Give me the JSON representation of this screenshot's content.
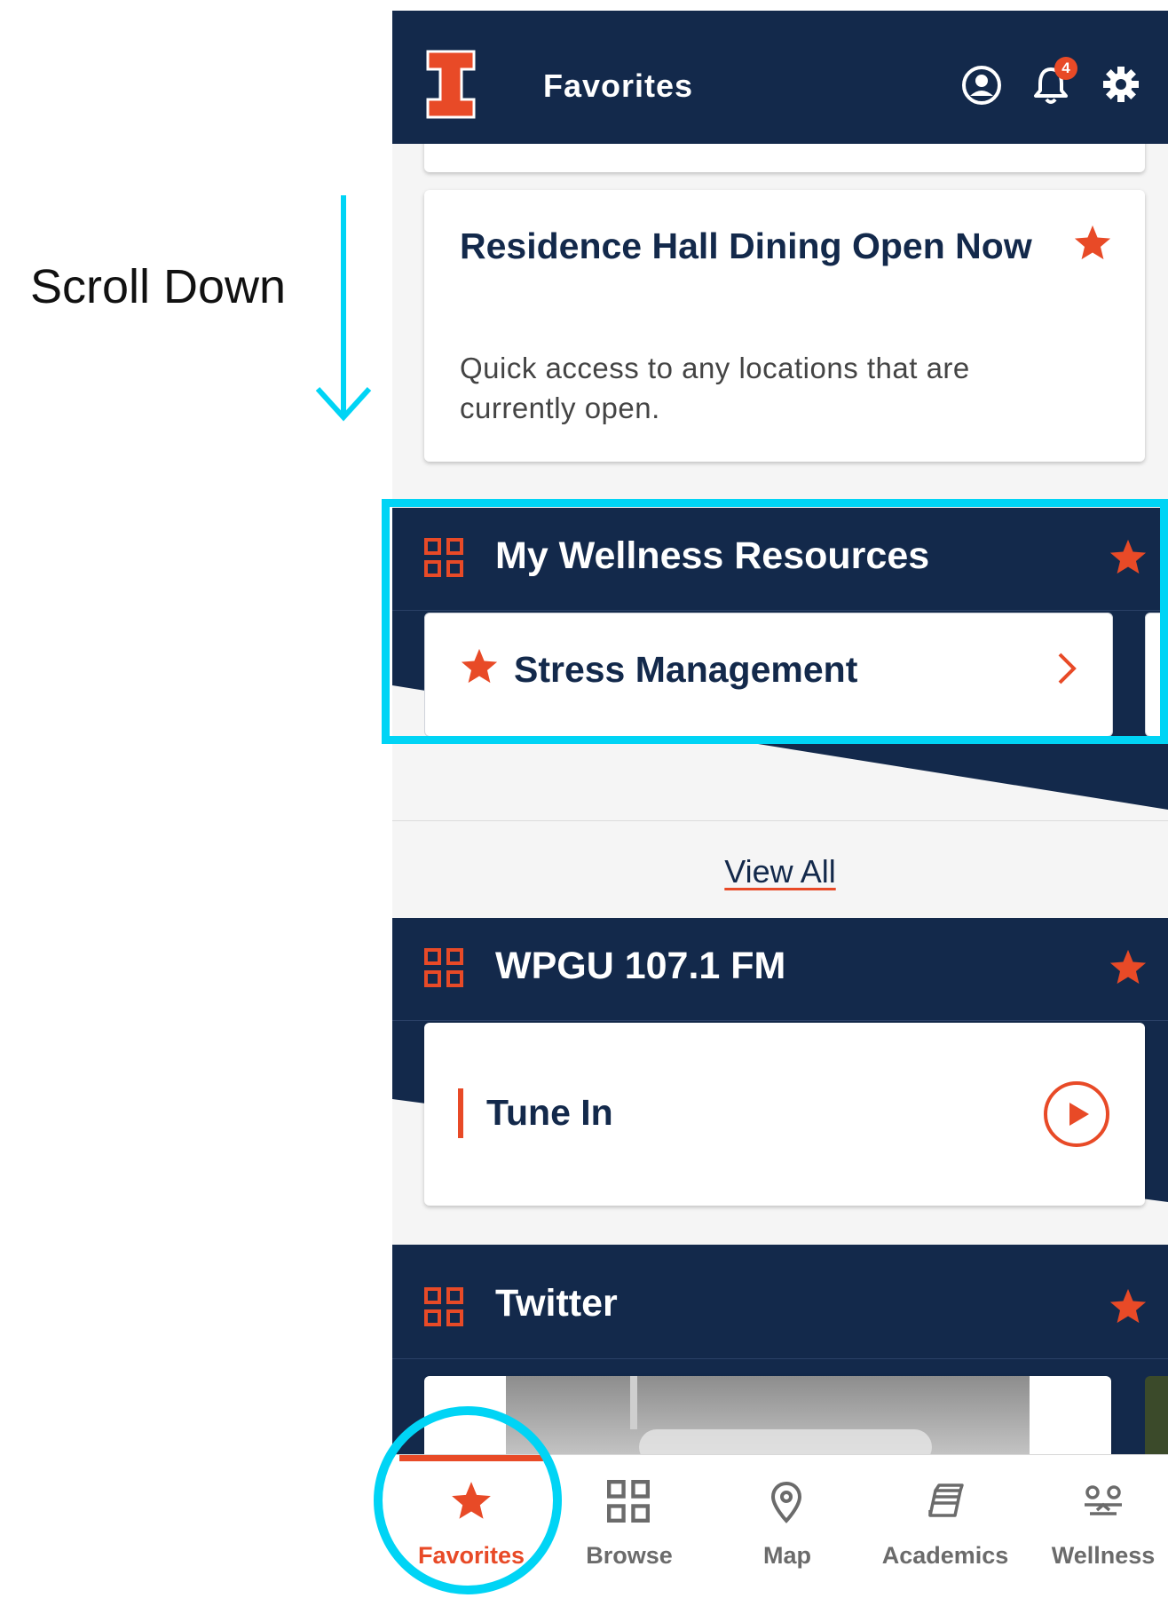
{
  "annotation": {
    "instruction": "Scroll Down"
  },
  "header": {
    "title": "Favorites",
    "notification_count": "4"
  },
  "cards": {
    "dining": {
      "title": "Residence Hall Dining Open Now",
      "description": "Quick access to any locations that are currently open."
    }
  },
  "wellness_section": {
    "title": "My Wellness Resources",
    "item": {
      "label": "Stress Management"
    }
  },
  "view_all": "View All",
  "radio_section": {
    "title": "WPGU 107.1 FM",
    "item": {
      "label": "Tune In"
    }
  },
  "twitter_section": {
    "title": "Twitter"
  },
  "bottom_nav": {
    "tabs": [
      {
        "label": "Favorites",
        "icon": "star-icon"
      },
      {
        "label": "Browse",
        "icon": "grid-icon"
      },
      {
        "label": "Map",
        "icon": "map-pin-icon"
      },
      {
        "label": "Academics",
        "icon": "books-icon"
      },
      {
        "label": "Wellness",
        "icon": "wellness-icon"
      }
    ],
    "active": "Favorites"
  },
  "colors": {
    "navy": "#13294b",
    "orange": "#e84a27",
    "highlight": "#00d4f5"
  }
}
